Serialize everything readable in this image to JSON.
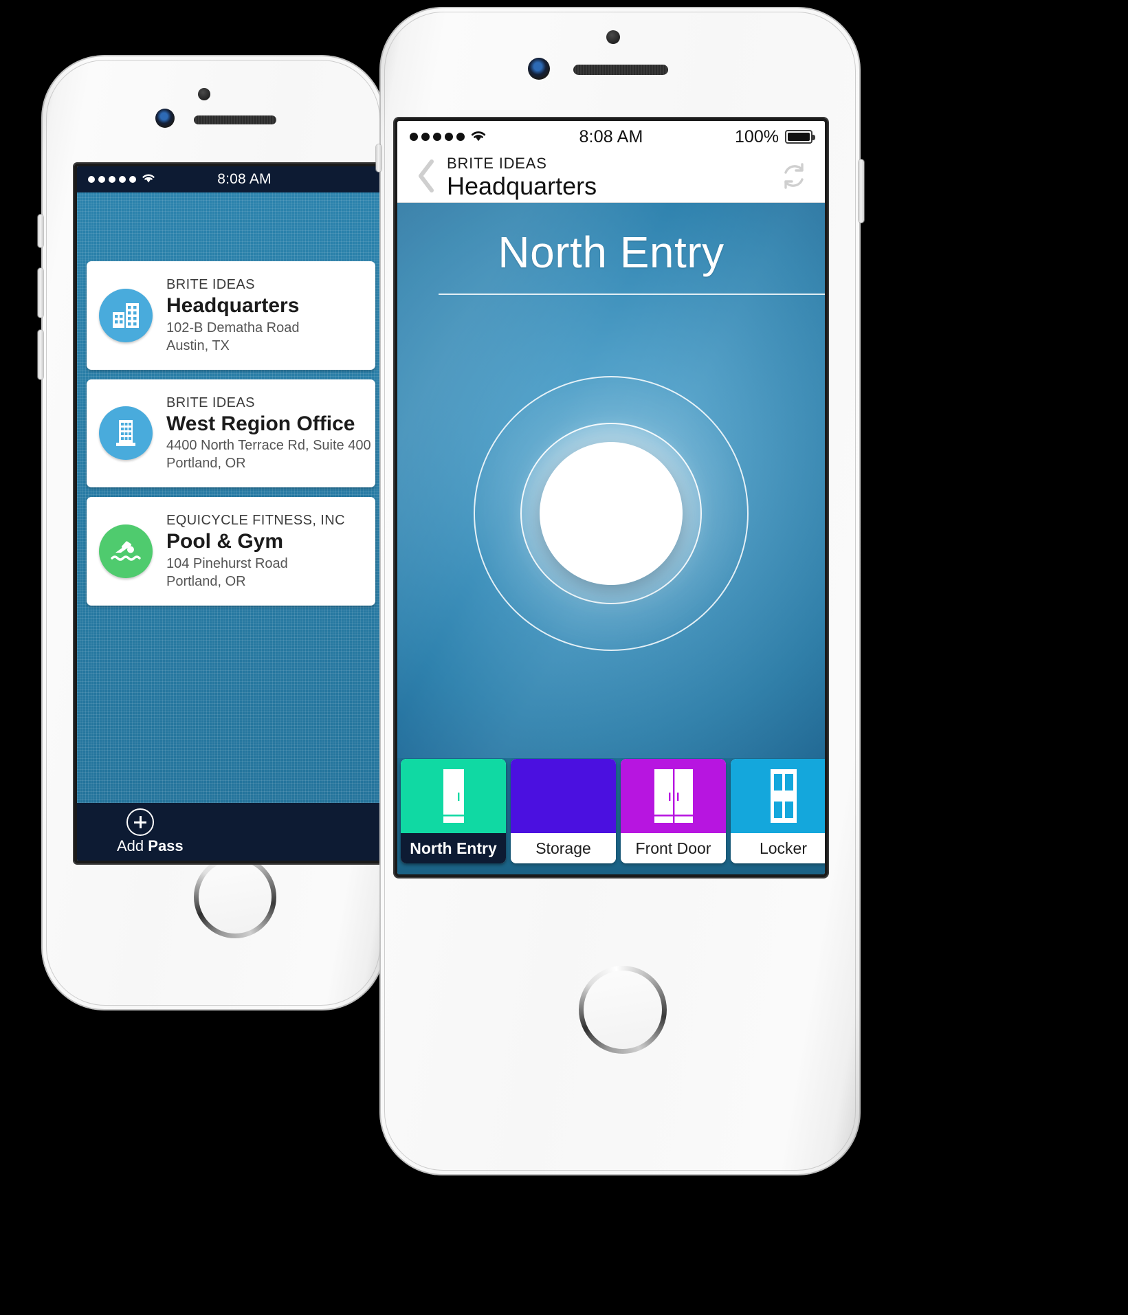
{
  "back_phone": {
    "status_bar": {
      "signal_dots": 5,
      "wifi_icon": "wifi-icon",
      "time": "8:08 AM"
    },
    "pass_list": [
      {
        "org": "BRITE IDEAS",
        "name": "Headquarters",
        "address_line1": "102-B Dematha Road",
        "address_line2": "Austin, TX",
        "icon": "office-buildings-icon",
        "icon_color": "#49ABDC"
      },
      {
        "org": "BRITE IDEAS",
        "name": "West Region Office",
        "address_line1": "4400 North Terrace Rd, Suite 400",
        "address_line2": "Portland, OR",
        "icon": "office-tower-icon",
        "icon_color": "#49ABDC"
      },
      {
        "org": "EQUICYCLE FITNESS, INC",
        "name": "Pool & Gym",
        "address_line1": "104 Pinehurst Road",
        "address_line2": "Portland, OR",
        "icon": "swimmer-icon",
        "icon_color": "#4FCB6E"
      }
    ],
    "add_pass": {
      "icon": "plus-circle-icon",
      "label_light": "Add ",
      "label_bold": "Pass"
    }
  },
  "front_phone": {
    "status_bar": {
      "signal_dots": 5,
      "wifi_icon": "wifi-icon",
      "time": "8:08 AM",
      "battery_percent": "100%",
      "battery_icon": "battery-full-icon"
    },
    "nav_bar": {
      "back_icon": "chevron-left-icon",
      "org": "BRITE IDEAS",
      "title": "Headquarters",
      "refresh_icon": "refresh-icon"
    },
    "lock_screen": {
      "door_name": "North Entry",
      "unlock_button": "unlock-button",
      "background_color_center": "#5AA9CF",
      "background_color_edge": "#246F9C"
    },
    "door_tabs": [
      {
        "label": "North Entry",
        "color": "#10D9A3",
        "icon": "single-door-icon",
        "selected": true
      },
      {
        "label": "Storage",
        "color": "#4B10E0",
        "icon": "blank-icon",
        "selected": false
      },
      {
        "label": "Front Door",
        "color": "#B715E0",
        "icon": "double-door-icon",
        "selected": false
      },
      {
        "label": "Locker",
        "color": "#14A7DC",
        "icon": "locker-door-icon",
        "selected": false
      }
    ]
  }
}
